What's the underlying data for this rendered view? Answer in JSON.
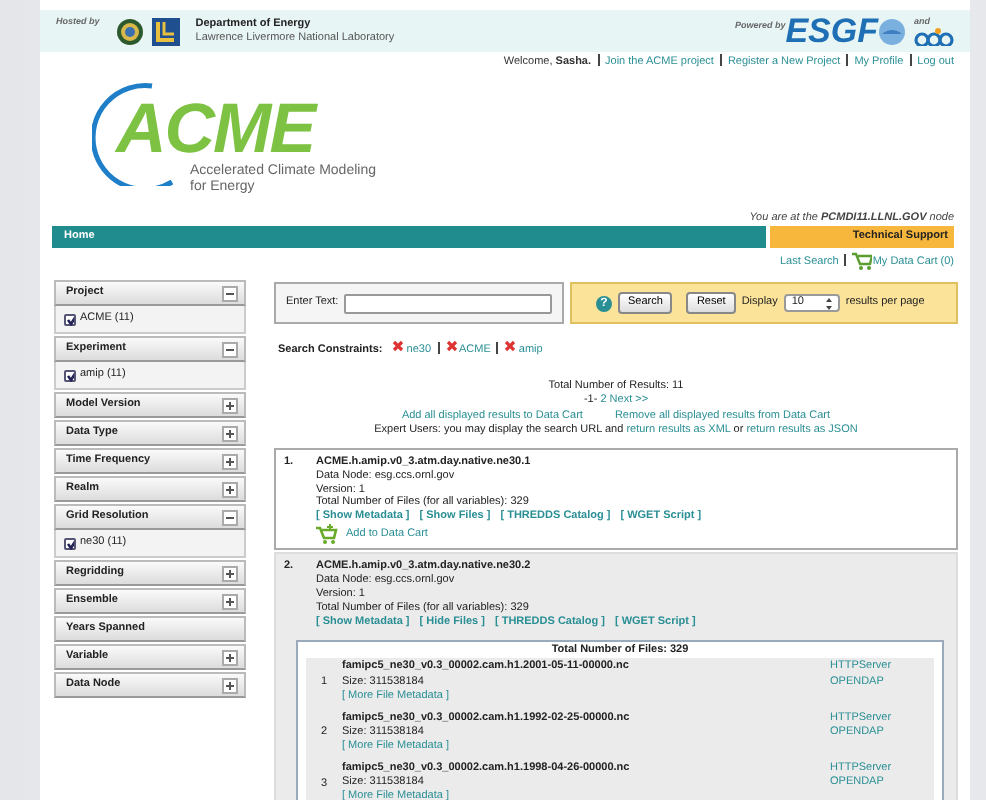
{
  "header": {
    "hosted_by": "Hosted by",
    "org_name": "Department of Energy",
    "org_sub": "Lawrence Livermore National Laboratory",
    "powered_by": "Powered by",
    "esgf": "ESGF",
    "and": "and"
  },
  "user_bar": {
    "welcome": "Welcome, **Sasha.**",
    "links": [
      "Join the ACME project",
      "Register a New Project",
      "My Profile",
      "Log out"
    ]
  },
  "logo": {
    "title": "ACME",
    "subtitle_lines": [
      "Accelerated Climate Modeling",
      "for Energy"
    ]
  },
  "node_notice": "You are at the **PCMDI11.LLNL.GOV** node",
  "nav": [
    {
      "label": "Home",
      "kind": "main"
    },
    {
      "label": "Technical Support",
      "kind": "support"
    }
  ],
  "cart_links": [
    "Last Search",
    "My Data Cart (0)"
  ],
  "facets": [
    {
      "title": "Project",
      "expanded": true,
      "items": [
        {
          "label": "ACME (11)",
          "checked": true
        }
      ]
    },
    {
      "title": "Experiment",
      "expanded": true,
      "items": [
        {
          "label": "amip (11)",
          "checked": true
        }
      ]
    },
    {
      "title": "Model Version",
      "expanded": false
    },
    {
      "title": "Data Type",
      "expanded": false
    },
    {
      "title": "Time Frequency",
      "expanded": false
    },
    {
      "title": "Realm",
      "expanded": false
    },
    {
      "title": "Grid Resolution",
      "expanded": true,
      "items": [
        {
          "label": "ne30 (11)",
          "checked": true
        }
      ]
    },
    {
      "title": "Regridding",
      "expanded": false
    },
    {
      "title": "Ensemble",
      "expanded": false
    },
    {
      "title": "Years Spanned"
    },
    {
      "title": "Variable",
      "expanded": false
    },
    {
      "title": "Data Node",
      "expanded": false
    }
  ],
  "search": {
    "label": "Enter Text:",
    "help": "?",
    "buttons": [
      "Search",
      "Reset"
    ],
    "display_label": "Display",
    "per_page": "10",
    "per_page_suffix": "results per page"
  },
  "constraints": {
    "label": "Search Constraints:",
    "items": [
      "ne30",
      "ACME",
      "amip"
    ]
  },
  "summary": {
    "total": "Total Number of Results: 11",
    "current_page": "-1-",
    "pages": [
      "2",
      "Next >>"
    ],
    "add_all": "Add all displayed results to Data Cart",
    "remove_all": "Remove all displayed results from Data Cart",
    "expert": [
      "Expert Users: you may display the search URL and ",
      "return results as XML",
      " or ",
      "return results as JSON"
    ]
  },
  "results": [
    {
      "index": "1.",
      "title": "ACME.h.amip.v0_3.atm.day.native.ne30.1",
      "data_node": "Data Node: esg.ccs.ornl.gov",
      "version": "Version: 1",
      "total_files": "Total Number of Files (for all variables): 329",
      "links": [
        "[ Show Metadata ]",
        "[ Show Files ]",
        "[ THREDDS Catalog ]",
        "[ WGET Script ]"
      ],
      "add_to_cart": "Add to Data Cart",
      "selected": false
    },
    {
      "index": "2.",
      "title": "ACME.h.amip.v0_3.atm.day.native.ne30.2",
      "data_node": "Data Node: esg.ccs.ornl.gov",
      "version": "Version: 1",
      "total_files": "Total Number of Files (for all variables): 329",
      "links": [
        "[ Show Metadata ]",
        "[ Hide Files ]",
        "[ THREDDS Catalog ]",
        "[ WGET Script ]"
      ],
      "selected": true,
      "files": {
        "title": "Total Number of Files: 329",
        "items": [
          {
            "index": "1",
            "name": "famipc5_ne30_v0.3_00002.cam.h1.2001-05-11-00000.nc",
            "size": "Size: 311538184",
            "metadata": "[ More File Metadata ]",
            "services": [
              "HTTPServer",
              "OPENDAP"
            ]
          },
          {
            "index": "2",
            "name": "famipc5_ne30_v0.3_00002.cam.h1.1992-02-25-00000.nc",
            "size": "Size: 311538184",
            "metadata": "[ More File Metadata ]",
            "services": [
              "HTTPServer",
              "OPENDAP"
            ]
          },
          {
            "index": "3",
            "name": "famipc5_ne30_v0.3_00002.cam.h1.1998-04-26-00000.nc",
            "size": "Size: 311538184",
            "metadata": "[ More File Metadata ]",
            "services": [
              "HTTPServer",
              "OPENDAP"
            ]
          }
        ]
      }
    }
  ]
}
